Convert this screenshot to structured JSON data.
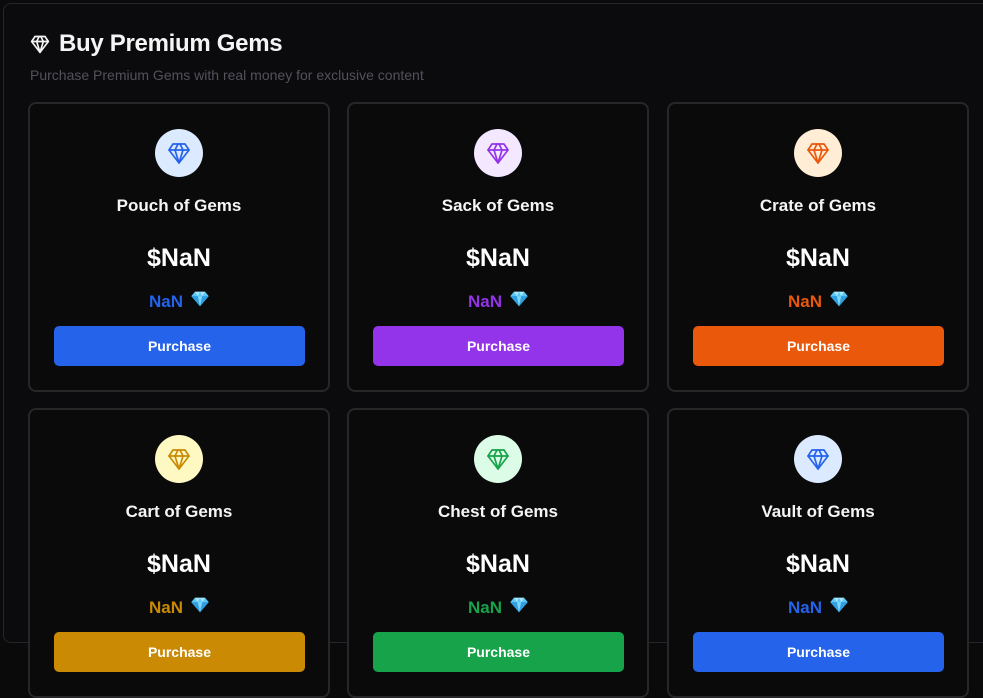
{
  "header": {
    "title": "Buy Premium Gems",
    "subtitle": "Purchase Premium Gems with real money for exclusive content"
  },
  "packs": [
    {
      "name": "Pouch of Gems",
      "price": "$NaN",
      "gems": "NaN",
      "button": "Purchase",
      "accent": "#2563eb",
      "icon_bg": "#dbeafe"
    },
    {
      "name": "Sack of Gems",
      "price": "$NaN",
      "gems": "NaN",
      "button": "Purchase",
      "accent": "#9333ea",
      "icon_bg": "#f3e8ff"
    },
    {
      "name": "Crate of Gems",
      "price": "$NaN",
      "gems": "NaN",
      "button": "Purchase",
      "accent": "#ea580c",
      "icon_bg": "#ffedd5"
    },
    {
      "name": "Cart of Gems",
      "price": "$NaN",
      "gems": "NaN",
      "button": "Purchase",
      "accent": "#ca8a04",
      "icon_bg": "#fef9c3"
    },
    {
      "name": "Chest of Gems",
      "price": "$NaN",
      "gems": "NaN",
      "button": "Purchase",
      "accent": "#16a34a",
      "icon_bg": "#dcfce7"
    },
    {
      "name": "Vault of Gems",
      "price": "$NaN",
      "gems": "NaN",
      "button": "Purchase",
      "accent": "#2563eb",
      "icon_bg": "#dbeafe"
    }
  ],
  "icons": {
    "header": "gem-icon",
    "pack": "gem-icon",
    "gem_emoji": "gem-stone-emoji"
  }
}
